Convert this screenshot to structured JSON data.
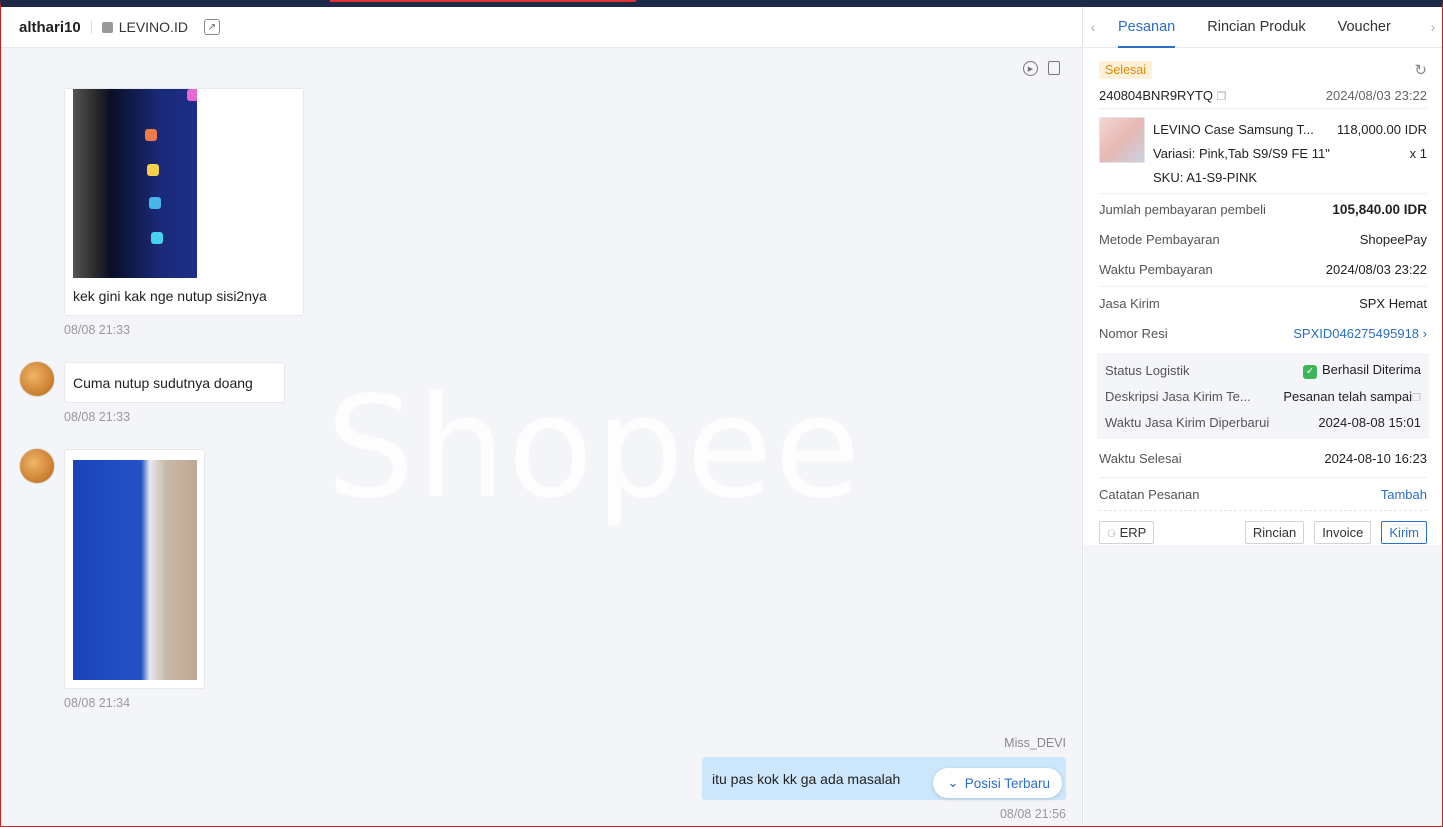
{
  "chat": {
    "username": "althari10",
    "shop_name": "LEVINO.ID",
    "watermark": "Shopee",
    "messages": [
      {
        "text": "kek gini kak nge nutup sisi2nya",
        "time": "08/08 21:33"
      },
      {
        "text": "Cuma nutup sudutnya doang",
        "time": "08/08 21:33"
      },
      {
        "time": "08/08 21:34"
      }
    ],
    "outgoing": {
      "sender": "Miss_DEVI",
      "text": "itu pas kok kk ga ada masalah",
      "time": "08/08 21:56"
    },
    "latest_button": "Posisi Terbaru"
  },
  "panel": {
    "tabs": [
      "Pesanan",
      "Rincian Produk",
      "Voucher"
    ],
    "status": "Selesai",
    "order_id": "240804BNR9RYTQ",
    "order_time": "2024/08/03 23:22",
    "product": {
      "name": "LEVINO Case Samsung T...",
      "price": "118,000.00 IDR",
      "variant": "Variasi:  Pink,Tab S9/S9 FE 11\"",
      "qty": "x 1",
      "sku": "SKU:  A1-S9-PINK"
    },
    "payment_amount_label": "Jumlah pembayaran pembeli",
    "payment_amount": "105,840.00 IDR",
    "payment_method_label": "Metode Pembayaran",
    "payment_method": "ShopeePay",
    "payment_time_label": "Waktu Pembayaran",
    "payment_time": "2024/08/03 23:22",
    "courier_label": "Jasa Kirim",
    "courier": "SPX Hemat",
    "tracking_label": "Nomor Resi",
    "tracking": "SPXID046275495918",
    "logistics": {
      "status_label": "Status Logistik",
      "status": "Berhasil Diterima",
      "desc_label": "Deskripsi Jasa Kirim Te...",
      "desc": "Pesanan telah sampai",
      "updated_label": "Waktu Jasa Kirim Diperbarui",
      "updated": "2024-08-08 15:01"
    },
    "completed_label": "Waktu Selesai",
    "completed": "2024-08-10 16:23",
    "note_label": "Catatan Pesanan",
    "note_action": "Tambah",
    "buttons": {
      "erp": "ERP",
      "details": "Rincian",
      "invoice": "Invoice",
      "send": "Kirim"
    }
  },
  "colors": {
    "accent": "#2a6fc9",
    "badge": "#e08a00",
    "bubble_out": "#cce7fb"
  }
}
